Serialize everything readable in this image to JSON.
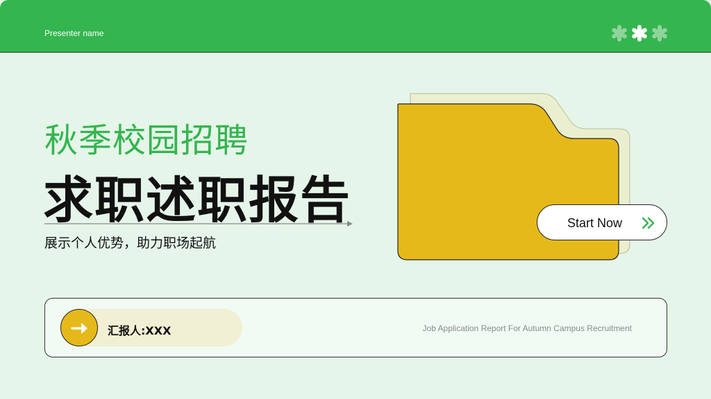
{
  "header": {
    "presenter_label": "Presenter name",
    "decor_icon": "asterisk-flower-icons"
  },
  "hero": {
    "subtitle": "秋季校园招聘",
    "title": "求职述职报告",
    "tagline": "展示个人优势，助力职场起航"
  },
  "cta": {
    "label": "Start Now",
    "icon": "double-chevron-right-icon"
  },
  "footer_card": {
    "reporter": "汇报人:XXX",
    "reporter_icon": "arrow-right-icon",
    "english_subtitle": "Job Application Report For Autumn Campus Recruitment"
  },
  "colors": {
    "background": "#e6f5e9",
    "brand_green": "#34b54f",
    "folder_yellow": "#e6b91a",
    "folder_back": "#e9efcf",
    "pill": "#f2f0d4"
  }
}
